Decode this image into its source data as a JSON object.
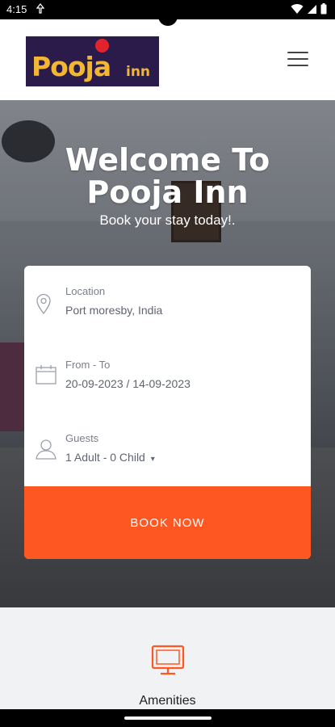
{
  "status_bar": {
    "time": "4:15"
  },
  "header": {
    "logo_main": "Pooja",
    "logo_sub": "inn"
  },
  "hero": {
    "title_line1": "Welcome To",
    "title_line2": "Pooja Inn",
    "subtitle": "Book your stay today!."
  },
  "booking": {
    "location": {
      "label": "Location",
      "value": "Port moresby, India",
      "icon": "location-pin-icon"
    },
    "dates": {
      "label": "From - To",
      "value": "20-09-2023 / 14-09-2023",
      "icon": "calendar-icon"
    },
    "guests": {
      "label": "Guests",
      "value": "1 Adult - 0 Child",
      "icon": "person-icon"
    },
    "book_button": "BOOK NOW"
  },
  "amenities": {
    "label": "Amenities",
    "icon": "monitor-icon"
  },
  "colors": {
    "accent": "#ff5722",
    "logo_bg": "#2b1b4a",
    "logo_text": "#f2b632"
  }
}
